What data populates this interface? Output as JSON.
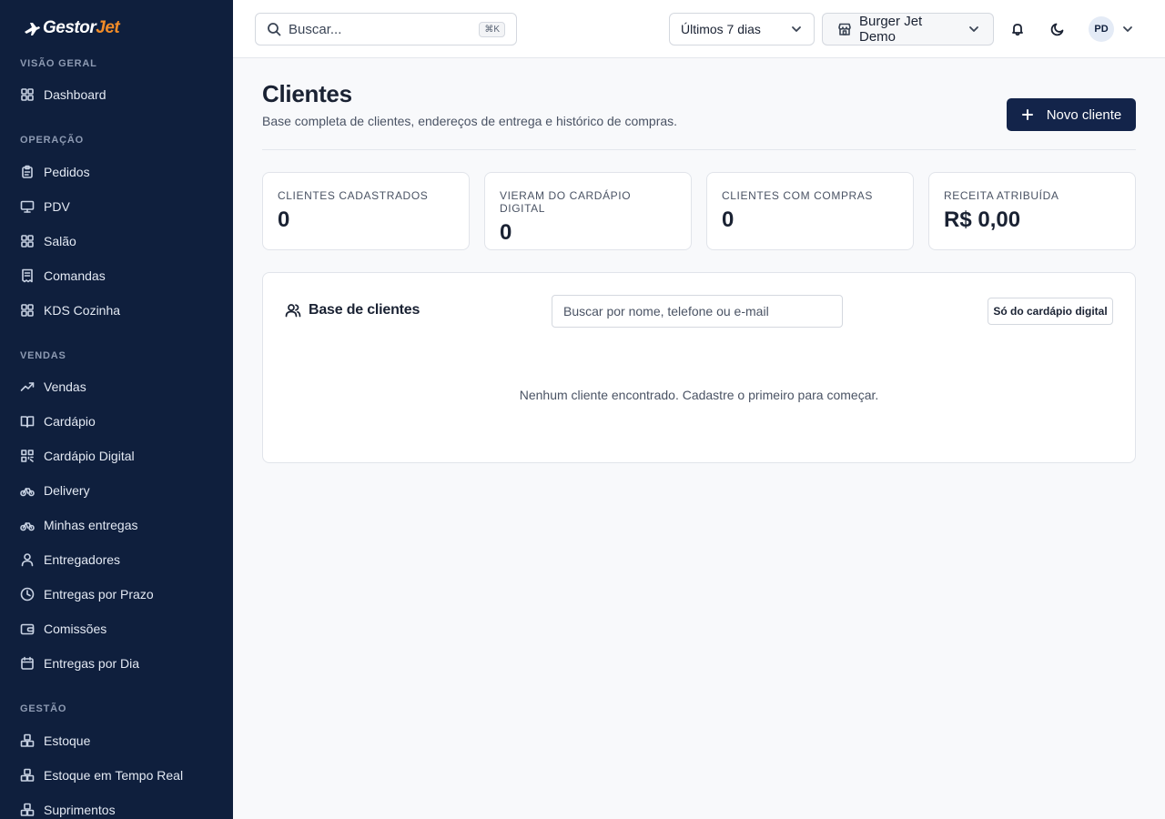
{
  "brand": {
    "name_part1": "Gestor",
    "name_part2": "Jet",
    "accent_color": "#f28c28",
    "sidebar_bg": "#0f1f3d"
  },
  "sidebar": {
    "sections": [
      {
        "label": "VISÃO GERAL"
      },
      {
        "label": "OPERAÇÃO"
      },
      {
        "label": "VENDAS"
      },
      {
        "label": "GESTÃO"
      }
    ],
    "items": [
      {
        "label": "Dashboard",
        "icon": "grid-icon"
      },
      {
        "label": "Pedidos",
        "icon": "clipboard-icon"
      },
      {
        "label": "PDV",
        "icon": "monitor-icon"
      },
      {
        "label": "Salão",
        "icon": "grid-icon"
      },
      {
        "label": "Comandas",
        "icon": "receipt-icon"
      },
      {
        "label": "KDS Cozinha",
        "icon": "grid-icon"
      },
      {
        "label": "Vendas",
        "icon": "trending-up-icon"
      },
      {
        "label": "Cardápio",
        "icon": "book-icon"
      },
      {
        "label": "Cardápio Digital",
        "icon": "qr-icon"
      },
      {
        "label": "Delivery",
        "icon": "bike-icon"
      },
      {
        "label": "Minhas entregas",
        "icon": "bike-icon"
      },
      {
        "label": "Entregadores",
        "icon": "user-icon"
      },
      {
        "label": "Entregas por Prazo",
        "icon": "clock-icon"
      },
      {
        "label": "Comissões",
        "icon": "wallet-icon"
      },
      {
        "label": "Entregas por Dia",
        "icon": "calendar-icon"
      },
      {
        "label": "Estoque",
        "icon": "boxes-icon"
      },
      {
        "label": "Estoque em Tempo Real",
        "icon": "boxes-icon"
      },
      {
        "label": "Suprimentos",
        "icon": "boxes-icon"
      }
    ]
  },
  "topbar": {
    "search_label": "Buscar...",
    "search_shortcut": "⌘K",
    "period": "Últimos 7 dias",
    "store": "Burger Jet Demo",
    "avatar_initials": "PD"
  },
  "page": {
    "title": "Clientes",
    "subtitle": "Base completa de clientes, endereços de entrega e histórico de compras.",
    "new_button": "Novo cliente"
  },
  "stats": [
    {
      "label": "CLIENTES CADASTRADOS",
      "value": "0"
    },
    {
      "label": "VIERAM DO CARDÁPIO DIGITAL",
      "value": "0"
    },
    {
      "label": "CLIENTES COM COMPRAS",
      "value": "0"
    },
    {
      "label": "RECEITA ATRIBUÍDA",
      "value": "R$ 0,00"
    }
  ],
  "panel": {
    "title": "Base de clientes",
    "search_placeholder": "Buscar por nome, telefone ou e-mail",
    "filter_label": "Só do cardápio digital",
    "empty_message": "Nenhum cliente encontrado. Cadastre o primeiro para começar."
  }
}
